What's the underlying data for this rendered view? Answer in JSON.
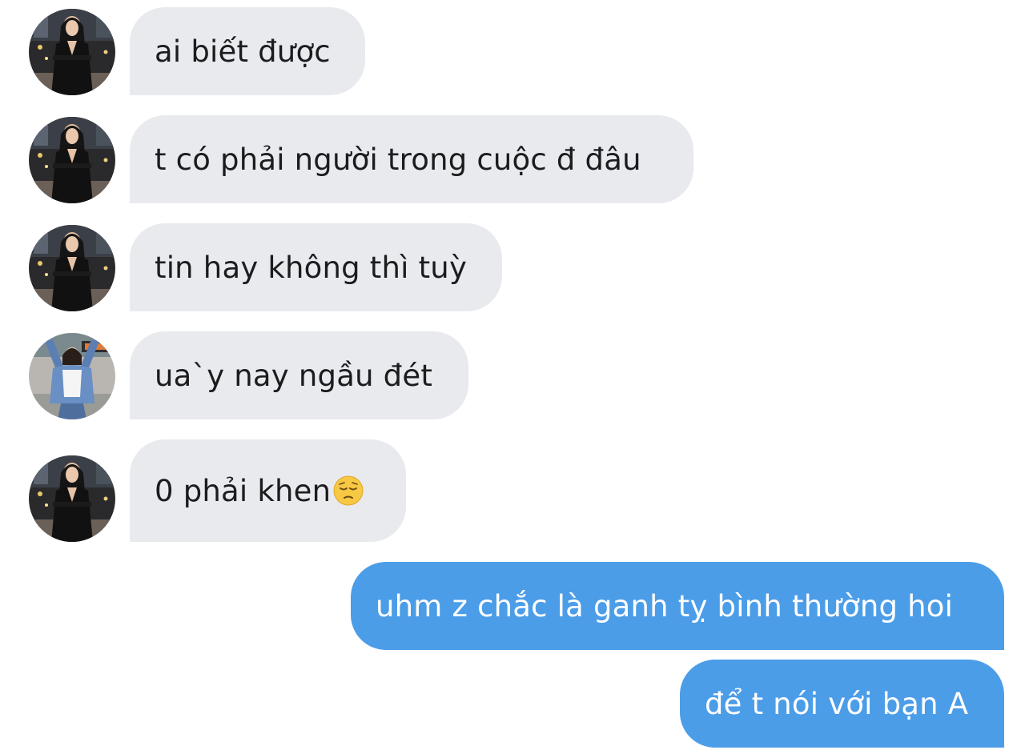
{
  "messages": [
    {
      "direction": "incoming",
      "sender_avatar": "avatar-photo-girl-black-dress",
      "text": "ai biết được"
    },
    {
      "direction": "incoming",
      "sender_avatar": "avatar-photo-girl-black-dress",
      "text": "t có phải người trong cuộc đ đâu"
    },
    {
      "direction": "incoming",
      "sender_avatar": "avatar-photo-girl-black-dress",
      "text": "tin hay không thì tuỳ"
    },
    {
      "direction": "incoming",
      "sender_avatar": "avatar-photo-girl-denim-jacket",
      "text": "ua`y nay ngầu đét"
    },
    {
      "direction": "incoming",
      "sender_avatar": "avatar-photo-girl-black-dress",
      "text": "0 phải khen",
      "emoji": "pensive-face-emoji"
    },
    {
      "direction": "outgoing",
      "text": "uhm z chắc là ganh tỵ bình thường hoi"
    },
    {
      "direction": "outgoing",
      "text": "để t nói với bạn A"
    }
  ],
  "colors": {
    "incoming_bubble": "#e8eaee",
    "outgoing_bubble": "#4c9de8",
    "incoming_text": "#1c1c1e",
    "outgoing_text": "#ffffff",
    "background": "#ffffff"
  }
}
